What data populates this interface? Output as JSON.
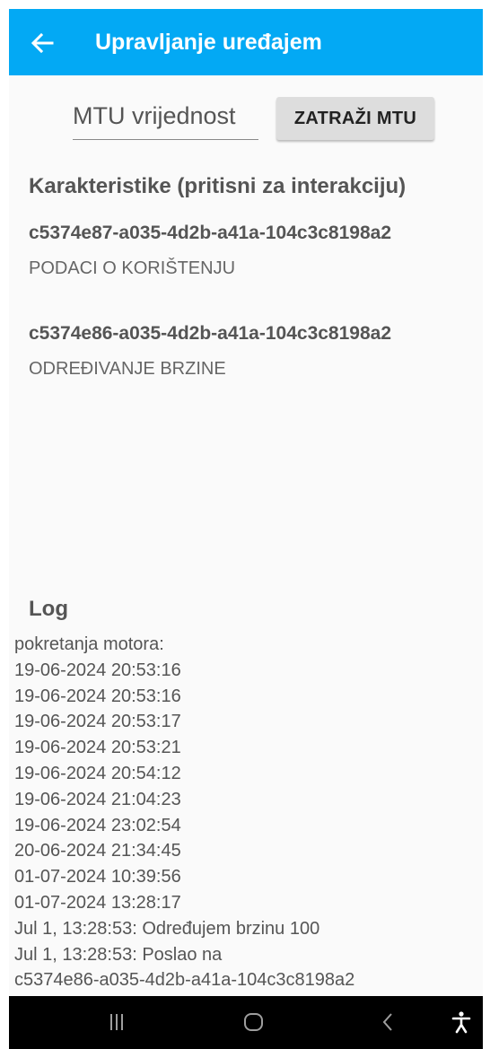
{
  "app_bar": {
    "title": "Upravljanje uređajem",
    "back_icon": "arrow-left-icon",
    "color": "#03a9f4"
  },
  "mtu": {
    "placeholder": "MTU vrijednost",
    "button_label": "ZATRAŽI MTU"
  },
  "characteristics": {
    "title": "Karakteristike (pritisni za interakciju)",
    "items": [
      {
        "uuid": "c5374e87-a035-4d2b-a41a-104c3c8198a2",
        "name": "PODACI O KORIŠTENJU"
      },
      {
        "uuid": "c5374e86-a035-4d2b-a41a-104c3c8198a2",
        "name": "ODREĐIVANJE BRZINE"
      }
    ]
  },
  "log": {
    "title": "Log",
    "lines": [
      "pokretanja motora:",
      "19-06-2024 20:53:16",
      "19-06-2024 20:53:16",
      "19-06-2024 20:53:17",
      "19-06-2024 20:53:21",
      "19-06-2024 20:54:12",
      "19-06-2024 21:04:23",
      "19-06-2024 23:02:54",
      "20-06-2024 21:34:45",
      "01-07-2024 10:39:56",
      "01-07-2024 13:28:17",
      "Jul 1, 13:28:53: Određujem brzinu 100",
      "Jul 1, 13:28:53: Poslao na",
      "c5374e86-a035-4d2b-a41a-104c3c8198a2"
    ]
  },
  "nav_bar": {
    "icons": [
      "recent-apps-icon",
      "home-icon",
      "back-icon",
      "accessibility-icon"
    ]
  }
}
